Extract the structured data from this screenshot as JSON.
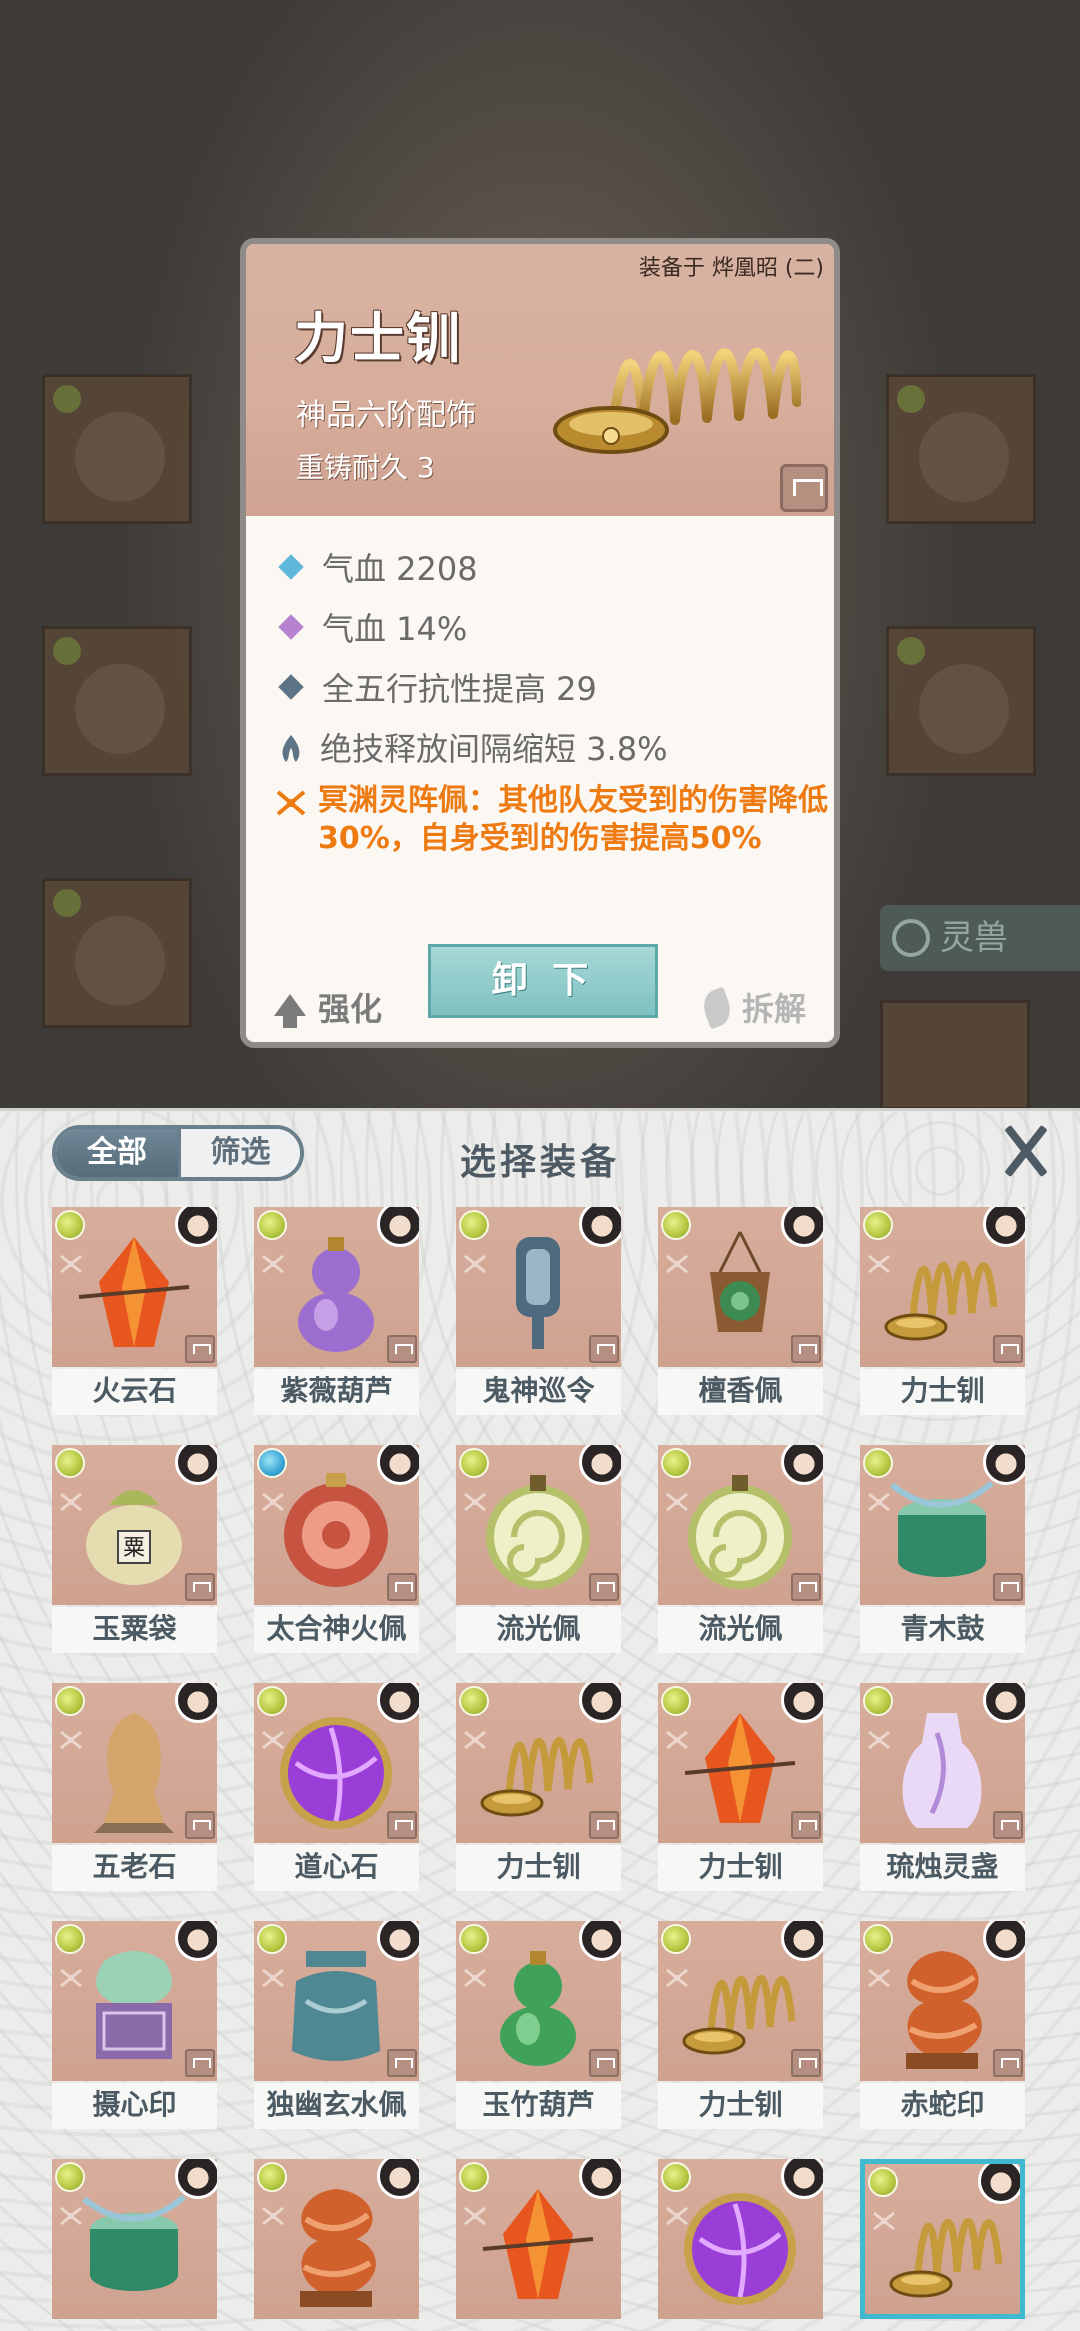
{
  "background": {
    "side_tab_label": "灵兽"
  },
  "detail_card": {
    "equipped_by": "装备于 烨凰昭 (二)",
    "item_name": "力士钏",
    "grade": "神品六阶配饰",
    "durability": "重铸耐久 3",
    "stats": [
      {
        "text": "气血 2208",
        "color": "#5fb8d9"
      },
      {
        "text": "气血 14%",
        "color": "#b783d1"
      },
      {
        "text": "全五行抗性提高 29",
        "color": "#5d7486"
      },
      {
        "text": "绝技释放间隔缩短 3.8%",
        "color": "#5d7486"
      }
    ],
    "special_effect": "冥渊灵阵佩：其他队友受到的伤害降低30%，自身受到的伤害提高50%",
    "actions": {
      "enhance": "强化",
      "unequip": "卸 下",
      "dismantle": "拆解"
    }
  },
  "panel": {
    "title": "选择装备",
    "segment_all": "全部",
    "segment_filter": "筛选",
    "items": [
      {
        "name": "火云石",
        "art": "crystal",
        "c1": "#e8561f",
        "c2": "#f6a13a"
      },
      {
        "name": "紫薇葫芦",
        "art": "gourd",
        "c1": "#9c6ed0",
        "c2": "#d9b5ef"
      },
      {
        "name": "鬼神巡令",
        "art": "token",
        "c1": "#4e6a7e",
        "c2": "#9bb6c4"
      },
      {
        "name": "檀香佩",
        "art": "pendant",
        "c1": "#3d8a52",
        "c2": "#7cc48e"
      },
      {
        "name": "力士钏",
        "art": "spring",
        "c1": "#c49a3b",
        "c2": "#eac46a"
      },
      {
        "name": "玉粟袋",
        "art": "bag",
        "c1": "#a8b85a",
        "c2": "#e5ddb0"
      },
      {
        "name": "太合神火佩",
        "art": "disc",
        "c1": "#c75441",
        "c2": "#ee9c88"
      },
      {
        "name": "流光佩",
        "art": "swirl",
        "c1": "#b4c06a",
        "c2": "#eef0c8"
      },
      {
        "name": "流光佩",
        "art": "swirl",
        "c1": "#b4c06a",
        "c2": "#eef0c8"
      },
      {
        "name": "青木鼓",
        "art": "drum",
        "c1": "#2f8a68",
        "c2": "#86c9ad"
      },
      {
        "name": "五老石",
        "art": "stone",
        "c1": "#8a6f55",
        "c2": "#d3a56a"
      },
      {
        "name": "道心石",
        "art": "orb",
        "c1": "#9a3ed8",
        "c2": "#e3a8ff"
      },
      {
        "name": "力士钏",
        "art": "spring",
        "c1": "#c49a3b",
        "c2": "#eac46a"
      },
      {
        "name": "力士钏",
        "art": "crystal",
        "c1": "#e8561f",
        "c2": "#f6a13a"
      },
      {
        "name": "琉烛灵盏",
        "art": "vase",
        "c1": "#b28ad8",
        "c2": "#ead9f6"
      },
      {
        "name": "摄心印",
        "art": "seal",
        "c1": "#8a6aa8",
        "c2": "#9bd2b6"
      },
      {
        "name": "独幽玄水佩",
        "art": "jar",
        "c1": "#4f8793",
        "c2": "#a9cdd2"
      },
      {
        "name": "玉竹葫芦",
        "art": "gourd",
        "c1": "#3fa258",
        "c2": "#9ce0a8"
      },
      {
        "name": "力士钏",
        "art": "spring",
        "c1": "#c49a3b",
        "c2": "#eac46a"
      },
      {
        "name": "赤蛇印",
        "art": "snake",
        "c1": "#d0602c",
        "c2": "#f0a070"
      },
      {
        "name": "",
        "art": "drum",
        "c1": "#2f8a68",
        "c2": "#86c9ad"
      },
      {
        "name": "",
        "art": "snake",
        "c1": "#d0602c",
        "c2": "#f0a070"
      },
      {
        "name": "",
        "art": "crystal",
        "c1": "#e8561f",
        "c2": "#f6a13a"
      },
      {
        "name": "",
        "art": "orb",
        "c1": "#9a3ed8",
        "c2": "#e3a8ff"
      },
      {
        "name": "",
        "art": "spring",
        "c1": "#c49a3b",
        "c2": "#eac46a",
        "selected": true
      }
    ]
  }
}
